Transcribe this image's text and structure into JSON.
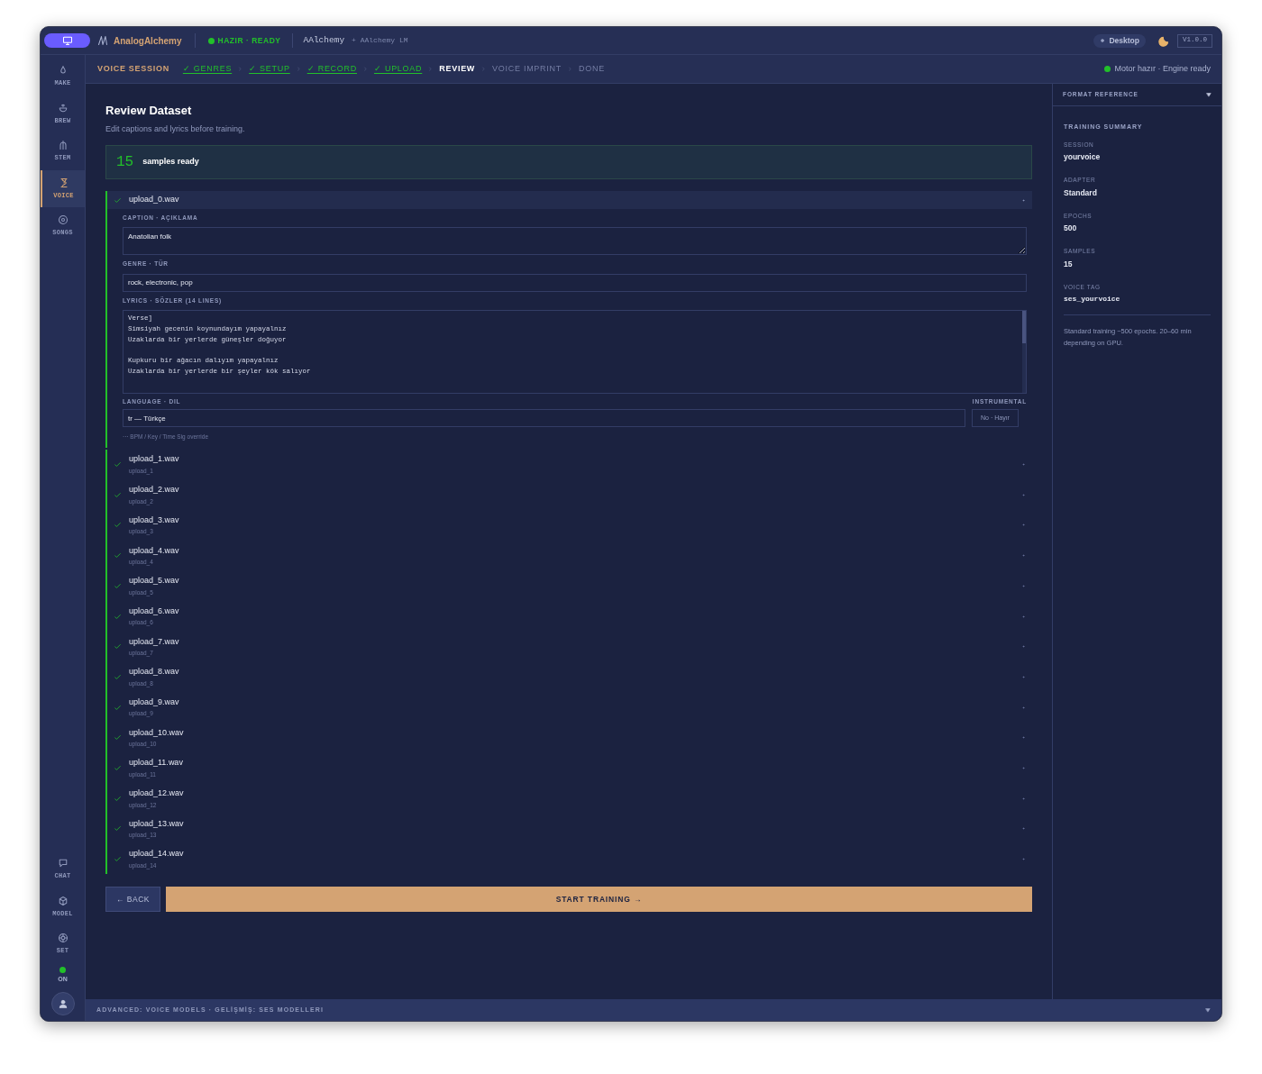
{
  "topbar": {
    "brand": "AnalogAlchemy",
    "status": "HAZIR · READY",
    "model": "AAlchemy",
    "model_extra": "+ AAlchemy LM",
    "platform": "Desktop",
    "version": "V1.0.0"
  },
  "sidebar": {
    "items": [
      {
        "label": "MAKE",
        "selected": false
      },
      {
        "label": "BREW",
        "selected": false
      },
      {
        "label": "STEM",
        "selected": false
      },
      {
        "label": "VOICE",
        "selected": true
      },
      {
        "label": "SONGS",
        "selected": false
      }
    ],
    "bottom_items": [
      {
        "label": "CHAT",
        "selected": false
      },
      {
        "label": "MODEL",
        "selected": false
      },
      {
        "label": "SET",
        "selected": false
      }
    ],
    "power": {
      "label": "ON",
      "on": true
    }
  },
  "steps": {
    "label": "VOICE SESSION",
    "items": [
      {
        "label": "✓ GENRES",
        "done": true,
        "selected": false
      },
      {
        "label": "✓ SETUP",
        "done": true,
        "selected": false
      },
      {
        "label": "✓ RECORD",
        "done": true,
        "selected": false
      },
      {
        "label": "✓ UPLOAD",
        "done": true,
        "selected": false
      },
      {
        "label": "REVIEW",
        "done": false,
        "selected": true
      },
      {
        "label": "VOICE IMPRINT",
        "done": false,
        "selected": false
      },
      {
        "label": "DONE",
        "done": false,
        "selected": false
      }
    ],
    "engine_status": "Motor hazır · Engine ready"
  },
  "page": {
    "title": "Review Dataset",
    "subtitle": "Edit captions and lyrics before training."
  },
  "summary": {
    "count": "15",
    "label": "samples ready"
  },
  "samples": [
    {
      "name": "upload_0.wav",
      "checked": true,
      "expanded": true,
      "caption_label": "CAPTION · AÇIKLAMA",
      "caption": "Anatolian folk",
      "genre_label": "GENRE · TÜR",
      "genre": "rock, electronic, pop",
      "lyrics_label": "LYRICS · SÖZLER (14 LINES)",
      "lyrics": "Verse]\nSimsiyah gecenin koynundayım yapayalnız\nUzaklarda bir yerlerde güneşler doğuyor\n\nKupkuru bir ağacın dalıyım yapayalnız\nUzaklarda bir yerlerde bir şeyler kök salıyor",
      "language_label": "LANGUAGE · DIL",
      "language": "tr — Türkçe",
      "instrumental_label": "INSTRUMENTAL",
      "instrumental": "No · Hayır",
      "override": "··· BPM / Key / Time Sig override"
    },
    {
      "name": "upload_1.wav",
      "subtitle": "upload_1",
      "checked": true,
      "expanded": false
    },
    {
      "name": "upload_2.wav",
      "subtitle": "upload_2",
      "checked": true,
      "expanded": false
    },
    {
      "name": "upload_3.wav",
      "subtitle": "upload_3",
      "checked": true,
      "expanded": false
    },
    {
      "name": "upload_4.wav",
      "subtitle": "upload_4",
      "checked": true,
      "expanded": false
    },
    {
      "name": "upload_5.wav",
      "subtitle": "upload_5",
      "checked": true,
      "expanded": false
    },
    {
      "name": "upload_6.wav",
      "subtitle": "upload_6",
      "checked": true,
      "expanded": false
    },
    {
      "name": "upload_7.wav",
      "subtitle": "upload_7",
      "checked": true,
      "expanded": false
    },
    {
      "name": "upload_8.wav",
      "subtitle": "upload_8",
      "checked": true,
      "expanded": false
    },
    {
      "name": "upload_9.wav",
      "subtitle": "upload_9",
      "checked": true,
      "expanded": false
    },
    {
      "name": "upload_10.wav",
      "subtitle": "upload_10",
      "checked": true,
      "expanded": false
    },
    {
      "name": "upload_11.wav",
      "subtitle": "upload_11",
      "checked": true,
      "expanded": false
    },
    {
      "name": "upload_12.wav",
      "subtitle": "upload_12",
      "checked": true,
      "expanded": false
    },
    {
      "name": "upload_13.wav",
      "subtitle": "upload_13",
      "checked": true,
      "expanded": false
    },
    {
      "name": "upload_14.wav",
      "subtitle": "upload_14",
      "checked": true,
      "expanded": false
    }
  ],
  "actions": {
    "back": "← BACK",
    "start": "START TRAINING →"
  },
  "panel": {
    "header": "FORMAT REFERENCE",
    "title": "TRAINING SUMMARY",
    "fields": [
      {
        "label": "SESSION",
        "value": "yourvoice",
        "kind": "text"
      },
      {
        "label": "ADAPTER",
        "value": "Standard",
        "kind": "text"
      },
      {
        "label": "EPOCHS",
        "value": "500",
        "kind": "text"
      },
      {
        "label": "SAMPLES",
        "value": "15",
        "kind": "text"
      },
      {
        "label": "VOICE TAG",
        "value": "ses_yourvoice",
        "kind": "code"
      }
    ],
    "note": "Standard training ~500 epochs. 20–60 min depending on GPU."
  },
  "bottom_bar": {
    "label": "ADVANCED: VOICE MODELS · GELİŞMİŞ: SES MODELLERI"
  }
}
